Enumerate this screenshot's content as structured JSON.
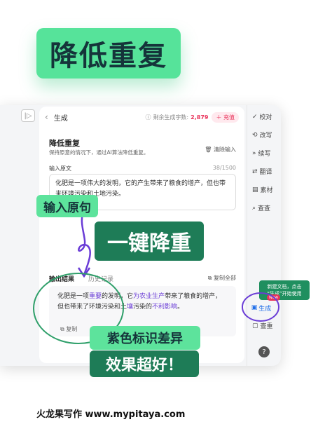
{
  "hero_title": "降低重复",
  "topbar": {
    "crumb": "生成",
    "remain_label": "剩余生成字数:",
    "remain_value": "2,879",
    "recharge": "充值"
  },
  "feature": {
    "title": "降低重复",
    "desc": "保持原意的情况下，通过AI算法降低重复。",
    "clear": "清除输入"
  },
  "input": {
    "label": "输入原文",
    "count": "38/1500",
    "text": "化肥是一项伟大的发明，它的产生带来了粮食的增产，但也带来环境污染和土地污染。"
  },
  "output": {
    "label": "输出结果",
    "history": "历史记录",
    "copy_all": "复制全部",
    "copy": "复制",
    "parts": [
      {
        "t": "化肥是一项",
        "h": false
      },
      {
        "t": "重要",
        "h": true
      },
      {
        "t": "的发明，它",
        "h": false
      },
      {
        "t": "为农业生产",
        "h": true
      },
      {
        "t": "带来了粮食的增产，但也带来了环境污染和土",
        "h": false
      },
      {
        "t": "壤",
        "h": true
      },
      {
        "t": "污染的",
        "h": false
      },
      {
        "t": "不利影响",
        "h": true
      },
      {
        "t": "。",
        "h": false
      }
    ]
  },
  "rail": {
    "items": [
      "校对",
      "改写",
      "续写",
      "翻译",
      "素材",
      "查查"
    ],
    "generate": "生成",
    "check": "查重",
    "new_badge": "New",
    "tip_line1": "新建文档，点击",
    "tip_line2": "“生成”开始使用"
  },
  "callouts": {
    "input_original": "输入原句",
    "one_click": "一键降重",
    "purple_marks": "紫色标识差异",
    "effect": "效果超好！"
  },
  "footer": "火龙果写作  www.mypitaya.com",
  "colors": {
    "accent_green": "#56e39a",
    "dark_green": "#1e7c57",
    "purple": "#6a3cd6",
    "pink": "#e9325a"
  }
}
